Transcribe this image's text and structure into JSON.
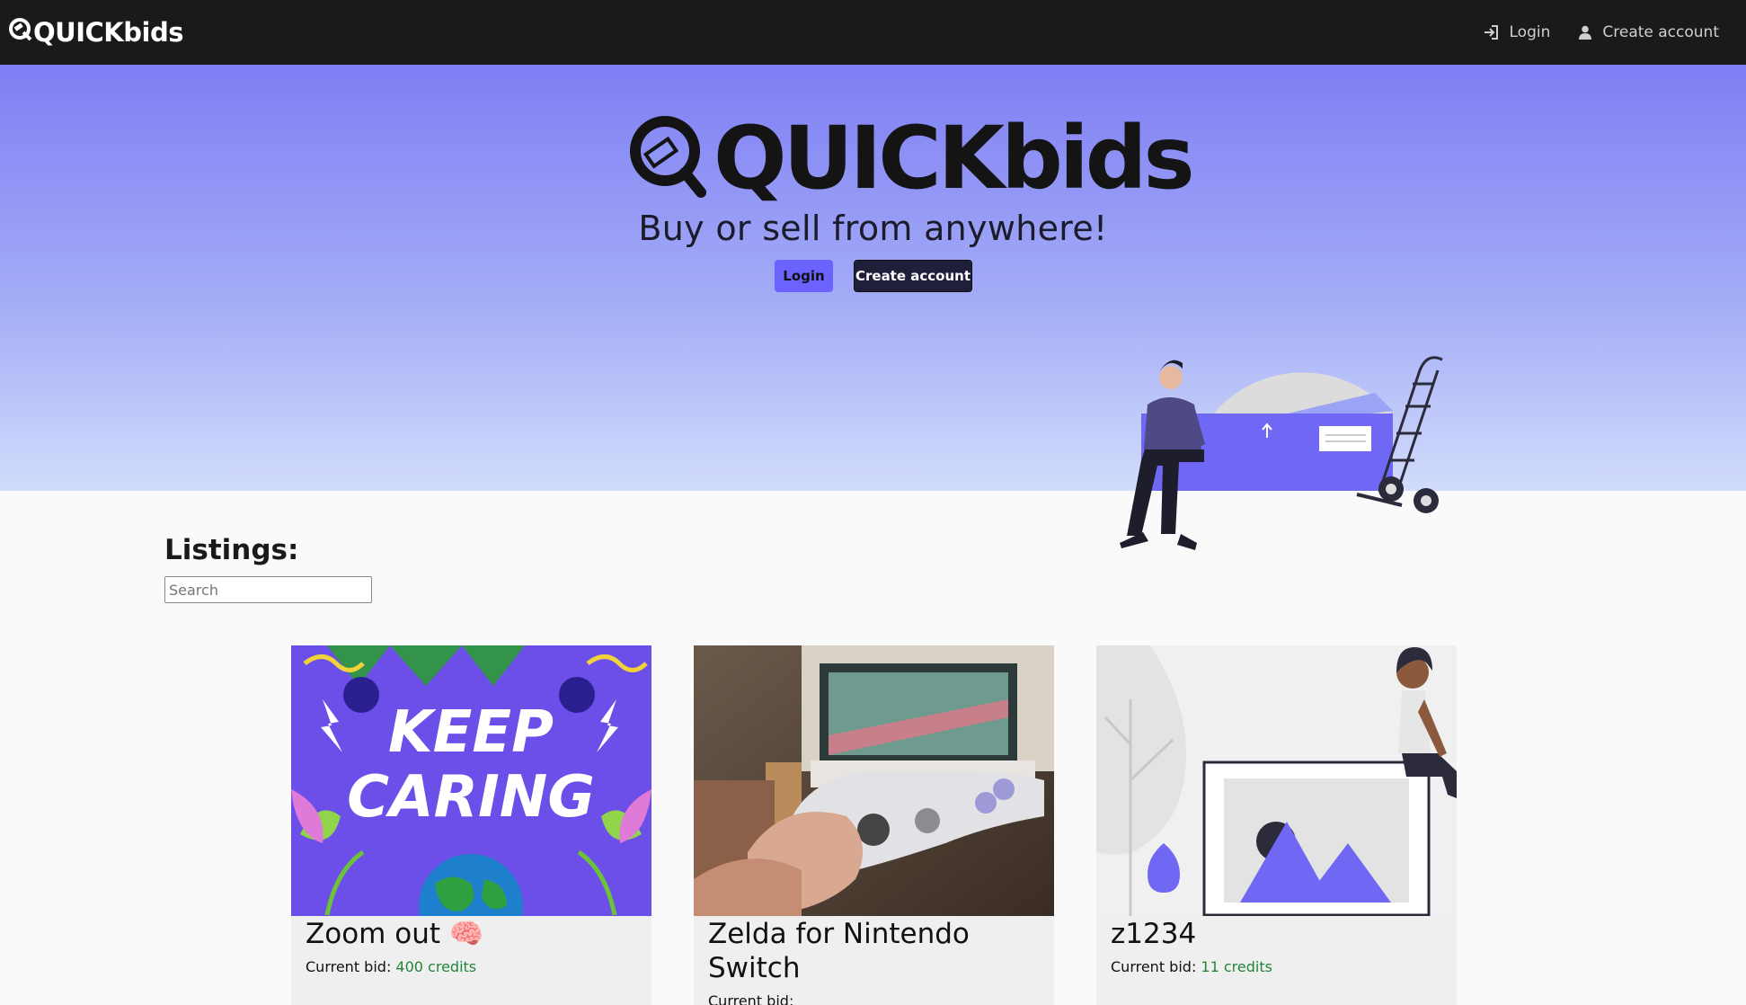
{
  "nav": {
    "brand": "QUICKbids",
    "login_label": "Login",
    "create_account_label": "Create account"
  },
  "hero": {
    "logo_text": "QUICKbids",
    "tagline": "Buy or sell from anywhere!",
    "login_button": "Login",
    "create_account_button": "Create account"
  },
  "listings": {
    "heading": "Listings:",
    "search_placeholder": "Search",
    "bid_prefix": "Current bid: ",
    "items": [
      {
        "title": "Zoom out 🧠",
        "bid": "400 credits",
        "image": "keep-caring-poster"
      },
      {
        "title": "Zelda for Nintendo Switch",
        "bid": "",
        "image": "game-controller-photo"
      },
      {
        "title": "z1234",
        "bid": "11 credits",
        "image": "placeholder-illustration"
      }
    ]
  },
  "colors": {
    "accent": "#6c63ff",
    "dark": "#1a1a1a",
    "bid_green": "#22863a"
  }
}
